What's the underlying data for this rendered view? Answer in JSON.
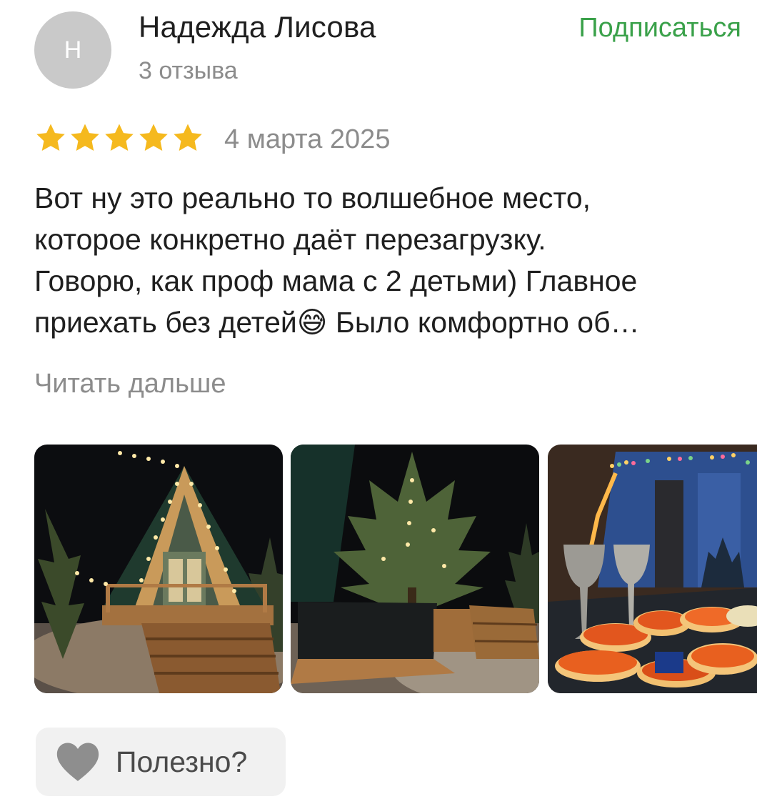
{
  "author": {
    "initial": "Н",
    "name": "Надежда Лисова",
    "reviews": "3 отзыва",
    "avatar_color": "#c9c9c9"
  },
  "subscribe_label": "Подписаться",
  "accent_color": "#3aa14a",
  "rating": {
    "stars": 5,
    "max": 5,
    "star_color": "#f5b91e"
  },
  "date": "4 марта 2025",
  "review_text": "Вот ну это реально то волшебное место,\nкоторое конкретно даёт перезагрузку.\nГоворю, как проф мама с 2 детьми) Главное\nприехать без детей😅 Было комфортно об…",
  "read_more_label": "Читать дальше",
  "photos": [
    {
      "icon": "photo-a-frame-cabin-night"
    },
    {
      "icon": "photo-pine-tree-hot-tub"
    },
    {
      "icon": "photo-interior-caviar-glasses"
    }
  ],
  "useful": {
    "label": "Полезно?",
    "icon": "heart-icon"
  }
}
